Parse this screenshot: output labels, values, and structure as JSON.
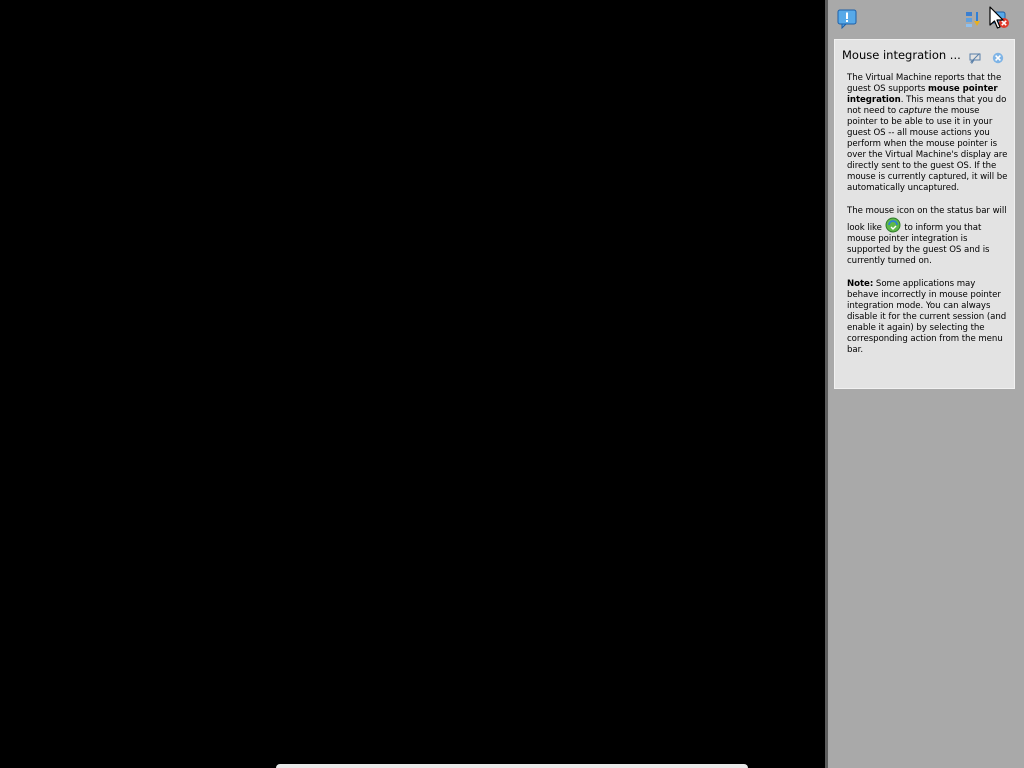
{
  "colors": {
    "pane_bg": "#a9a9a9",
    "pane_border": "#5e5e5e",
    "card_bg": "#e3e3e3",
    "accent_blue": "#2f7fd6",
    "close_red": "#e03a2a"
  },
  "toolbar": {
    "icons": [
      "notice-icon",
      "layout-icon",
      "close-all-icon"
    ]
  },
  "message": {
    "title": "Mouse integration ...",
    "buttons": [
      "suppress-icon",
      "close-icon"
    ],
    "p1": {
      "a": "The Virtual Machine reports that the guest OS supports ",
      "b": "mouse pointer integration",
      "c": ". This means that you do not need to ",
      "d": "capture",
      "e": " the mouse pointer to be able to use it in your guest OS -- all mouse actions you perform when the mouse pointer is over the Virtual Machine's display are directly sent to the guest OS. If the mouse is currently captured, it will be automatically uncaptured."
    },
    "p2": {
      "a": "The mouse icon on the status bar will look like ",
      "icon": "mouse-integration-icon",
      "b": " to inform you that mouse pointer integration is supported by the guest OS and is currently turned on."
    },
    "p3": {
      "a": "Note:",
      "b": " Some applications may behave incorrectly in mouse pointer integration mode. You can always disable it for the current session (and enable it again) by selecting the corresponding action from the menu bar."
    }
  }
}
